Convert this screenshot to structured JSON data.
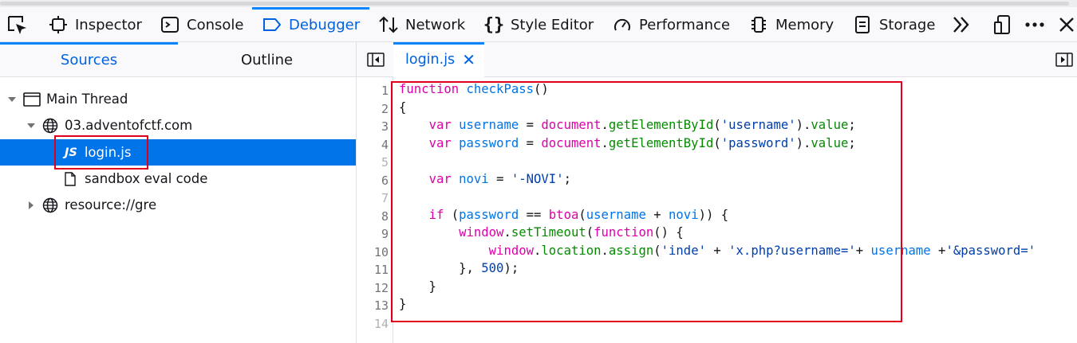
{
  "toolbar": {
    "tabs": [
      {
        "label": "Inspector",
        "icon": "inspector-icon"
      },
      {
        "label": "Console",
        "icon": "console-icon"
      },
      {
        "label": "Debugger",
        "icon": "debugger-icon",
        "active": true
      },
      {
        "label": "Network",
        "icon": "network-icon"
      },
      {
        "label": "Style Editor",
        "icon": "style-editor-icon"
      },
      {
        "label": "Performance",
        "icon": "performance-icon"
      },
      {
        "label": "Memory",
        "icon": "memory-icon"
      },
      {
        "label": "Storage",
        "icon": "storage-icon"
      }
    ],
    "accent": "#0061e0"
  },
  "sidebar": {
    "tabs": [
      {
        "label": "Sources",
        "active": true
      },
      {
        "label": "Outline"
      }
    ],
    "tree": [
      {
        "label": "Main Thread",
        "icon": "window-icon",
        "expanded": true
      },
      {
        "label": "03.adventofctf.com",
        "icon": "globe-icon",
        "expanded": true
      },
      {
        "label": "login.js",
        "icon": "js-file-icon",
        "selected": true,
        "badge": "JS"
      },
      {
        "label": "sandbox eval code",
        "icon": "file-icon"
      },
      {
        "label": "resource://gre",
        "icon": "globe-icon",
        "expanded": false
      }
    ]
  },
  "editor": {
    "tab": {
      "label": "login.js",
      "close": "✕"
    },
    "line_numbers": [
      "1",
      "2",
      "3",
      "4",
      "5",
      "6",
      "7",
      "8",
      "9",
      "10",
      "11",
      "12",
      "13",
      "14"
    ],
    "lines": [
      [
        [
          "kw",
          "function"
        ],
        [
          "pl",
          " "
        ],
        [
          "fn",
          "checkPass"
        ],
        [
          "pl",
          "()"
        ]
      ],
      [
        [
          "pl",
          "{"
        ]
      ],
      [
        [
          "pl",
          "    "
        ],
        [
          "kw",
          "var"
        ],
        [
          "pl",
          " "
        ],
        [
          "nm",
          "username"
        ],
        [
          "pl",
          " = "
        ],
        [
          "kw",
          "document"
        ],
        [
          "pl",
          "."
        ],
        [
          "prop",
          "getElementById"
        ],
        [
          "pl",
          "("
        ],
        [
          "str",
          "'username'"
        ],
        [
          "pl",
          ")."
        ],
        [
          "prop",
          "value"
        ],
        [
          "pl",
          ";"
        ]
      ],
      [
        [
          "pl",
          "    "
        ],
        [
          "kw",
          "var"
        ],
        [
          "pl",
          " "
        ],
        [
          "nm",
          "password"
        ],
        [
          "pl",
          " = "
        ],
        [
          "kw",
          "document"
        ],
        [
          "pl",
          "."
        ],
        [
          "prop",
          "getElementById"
        ],
        [
          "pl",
          "("
        ],
        [
          "str",
          "'password'"
        ],
        [
          "pl",
          ")."
        ],
        [
          "prop",
          "value"
        ],
        [
          "pl",
          ";"
        ]
      ],
      [],
      [
        [
          "pl",
          "    "
        ],
        [
          "kw",
          "var"
        ],
        [
          "pl",
          " "
        ],
        [
          "nm",
          "novi"
        ],
        [
          "pl",
          " = "
        ],
        [
          "str",
          "'-NOVI'"
        ],
        [
          "pl",
          ";"
        ]
      ],
      [],
      [
        [
          "pl",
          "    "
        ],
        [
          "kw",
          "if"
        ],
        [
          "pl",
          " ("
        ],
        [
          "nm",
          "password"
        ],
        [
          "pl",
          " == "
        ],
        [
          "kw",
          "btoa"
        ],
        [
          "pl",
          "("
        ],
        [
          "nm",
          "username"
        ],
        [
          "pl",
          " + "
        ],
        [
          "nm",
          "novi"
        ],
        [
          "pl",
          ")) {"
        ]
      ],
      [
        [
          "pl",
          "        "
        ],
        [
          "kw",
          "window"
        ],
        [
          "pl",
          "."
        ],
        [
          "prop",
          "setTimeout"
        ],
        [
          "pl",
          "("
        ],
        [
          "kw",
          "function"
        ],
        [
          "pl",
          "() {"
        ]
      ],
      [
        [
          "pl",
          "            "
        ],
        [
          "kw",
          "window"
        ],
        [
          "pl",
          "."
        ],
        [
          "prop",
          "location"
        ],
        [
          "pl",
          "."
        ],
        [
          "prop",
          "assign"
        ],
        [
          "pl",
          "("
        ],
        [
          "str",
          "'inde'"
        ],
        [
          "pl",
          " + "
        ],
        [
          "str",
          "'x.php?username='"
        ],
        [
          "pl",
          "+ "
        ],
        [
          "nm",
          "username"
        ],
        [
          "pl",
          " +"
        ],
        [
          "str",
          "'&password='"
        ]
      ],
      [
        [
          "pl",
          "        }, "
        ],
        [
          "num",
          "500"
        ],
        [
          "pl",
          ");"
        ]
      ],
      [
        [
          "pl",
          "    }"
        ]
      ],
      [
        [
          "pl",
          "}"
        ]
      ],
      []
    ]
  }
}
